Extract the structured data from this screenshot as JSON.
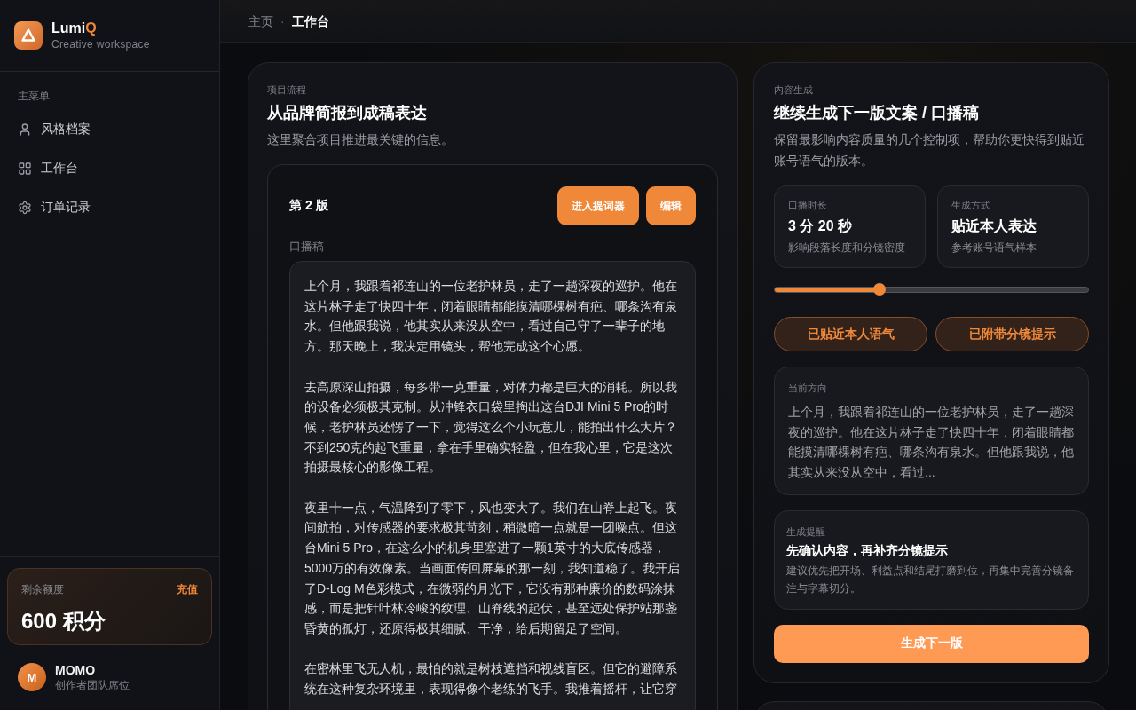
{
  "sidebar": {
    "brand": {
      "name": "Lumi",
      "name_accent": "Q",
      "tagline": "Creative workspace"
    },
    "menu_title": "主菜单",
    "items": [
      {
        "label": "风格档案",
        "selected": false
      },
      {
        "label": "工作台",
        "selected": false
      },
      {
        "label": "订单记录",
        "selected": false
      }
    ],
    "quota": {
      "label": "剩余额度",
      "action": "充值",
      "value": "600 积分"
    },
    "user": {
      "initial": "M",
      "name": "MOMO",
      "role": "创作者团队席位"
    }
  },
  "breadcrumb": {
    "separator": "·",
    "items": [
      {
        "label": "主页",
        "selected": false
      },
      {
        "label": "工作台",
        "selected": true
      }
    ]
  },
  "workflow": {
    "eyebrow": "项目流程",
    "title": "从品牌简报到成稿表达",
    "description": "这里聚合项目推进最关键的信息。",
    "version": {
      "title": "第 2 版",
      "buttons": [
        "进入提词器",
        "编辑"
      ],
      "script_label": "口播稿",
      "paragraphs": [
        "上个月，我跟着祁连山的一位老护林员，走了一趟深夜的巡护。他在这片林子走了快四十年，闭着眼睛都能摸清哪棵树有疤、哪条沟有泉水。但他跟我说，他其实从来没从空中，看过自己守了一辈子的地方。那天晚上，我决定用镜头，帮他完成这个心愿。",
        "去高原深山拍摄，每多带一克重量，对体力都是巨大的消耗。所以我的设备必须极其克制。从冲锋衣口袋里掏出这台DJI Mini 5 Pro的时候，老护林员还愣了一下，觉得这么个小玩意儿，能拍出什么大片？不到250克的起飞重量，拿在手里确实轻盈，但在我心里，它是这次拍摄最核心的影像工程。",
        "夜里十一点，气温降到了零下，风也变大了。我们在山脊上起飞。夜间航拍，对传感器的要求极其苛刻，稍微暗一点就是一团噪点。但这台Mini 5 Pro，在这么小的机身里塞进了一颗1英寸的大底传感器，5000万的有效像素。当画面传回屏幕的那一刻，我知道稳了。我开启了D-Log M色彩模式，在微弱的月光下，它没有那种廉价的数码涂抹感，而是把针叶林冷峻的纹理、山脊线的起伏，甚至远处保护站那盏昏黄的孤灯，还原得极其细腻、干净，给后期留足了空间。",
        "在密林里飞无人机，最怕的就是树枝遮挡和视线盲区。但它的避障系统在这种复杂环境里，表现得像个老练的飞手。我推着摇杆，让它穿"
      ]
    }
  },
  "generator": {
    "eyebrow": "内容生成",
    "title": "继续生成下一版文案 / 口播稿",
    "description": "保留最影响内容质量的几个控制项，帮助你更快得到贴近账号语气的版本。",
    "stats": [
      {
        "label": "口播时长",
        "value": "3 分 20 秒",
        "note": "影响段落长度和分镜密度"
      },
      {
        "label": "生成方式",
        "value": "贴近本人表达",
        "note": "参考账号语气样本"
      }
    ],
    "slider": {
      "level": 0.334
    },
    "toggles": [
      {
        "label": "已贴近本人语气",
        "selected": true
      },
      {
        "label": "已附带分镜提示",
        "selected": true
      }
    ],
    "direction": {
      "label": "当前方向",
      "text": "上个月，我跟着祁连山的一位老护林员，走了一趟深夜的巡护。他在这片林子走了快四十年，闭着眼睛都能摸清哪棵树有疤、哪条沟有泉水。但他跟我说，他其实从来没从空中，看过..."
    },
    "reminder": {
      "label": "生成提醒",
      "title": "先确认内容，再补齐分镜提示",
      "text": "建议优先把开场、利益点和结尾打磨到位，再集中完善分镜备注与字幕切分。"
    },
    "action": "生成下一版"
  }
}
